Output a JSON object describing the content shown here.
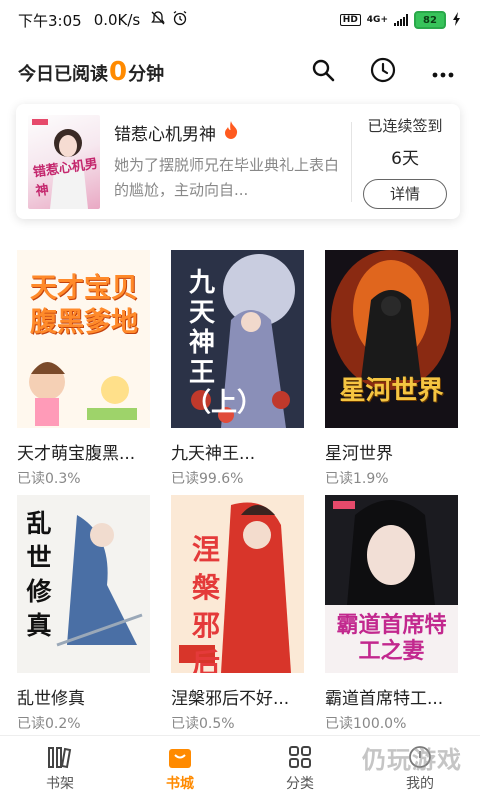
{
  "statusbar": {
    "time": "下午3:05",
    "speed": "0.0K/s",
    "hd": "HD",
    "network": "4G+",
    "battery": "82"
  },
  "header": {
    "title_prefix": "今日已阅读",
    "minutes": "0",
    "title_suffix": "分钟"
  },
  "recent": {
    "title": "错惹心机男神",
    "description": "她为了摆脱师兄在毕业典礼上表白的尴尬，主动向自...",
    "cover_text": "错惹心机男神",
    "sign_label": "已连续签到",
    "sign_days": "6天",
    "detail_button": "详情"
  },
  "books": [
    {
      "title": "天才萌宝腹黑...",
      "progress": "已读0.3%",
      "cover_text": "天才宝贝腹黑爹地"
    },
    {
      "title": "九天神王...",
      "progress": "已读99.6%",
      "cover_text": "九天神王（上）"
    },
    {
      "title": "星河世界",
      "progress": "已读1.9%",
      "cover_text": "星河世界"
    },
    {
      "title": "乱世修真",
      "progress": "已读0.2%",
      "cover_text": "乱世修真"
    },
    {
      "title": "涅槃邪后不好...",
      "progress": "已读0.5%",
      "cover_text": "涅槃邪后"
    },
    {
      "title": "霸道首席特工...",
      "progress": "已读100.0%",
      "cover_text": "霸道首席特工之妻"
    }
  ],
  "tabs": [
    {
      "label": "书架",
      "icon": "bookshelf-icon"
    },
    {
      "label": "书城",
      "icon": "bag-icon",
      "active": true
    },
    {
      "label": "分类",
      "icon": "grid-icon"
    },
    {
      "label": "我的",
      "icon": "profile-icon"
    }
  ],
  "watermark": "仍玩游戏",
  "colors": {
    "accent": "#ff8a00",
    "text": "#222222",
    "muted": "#888888"
  }
}
